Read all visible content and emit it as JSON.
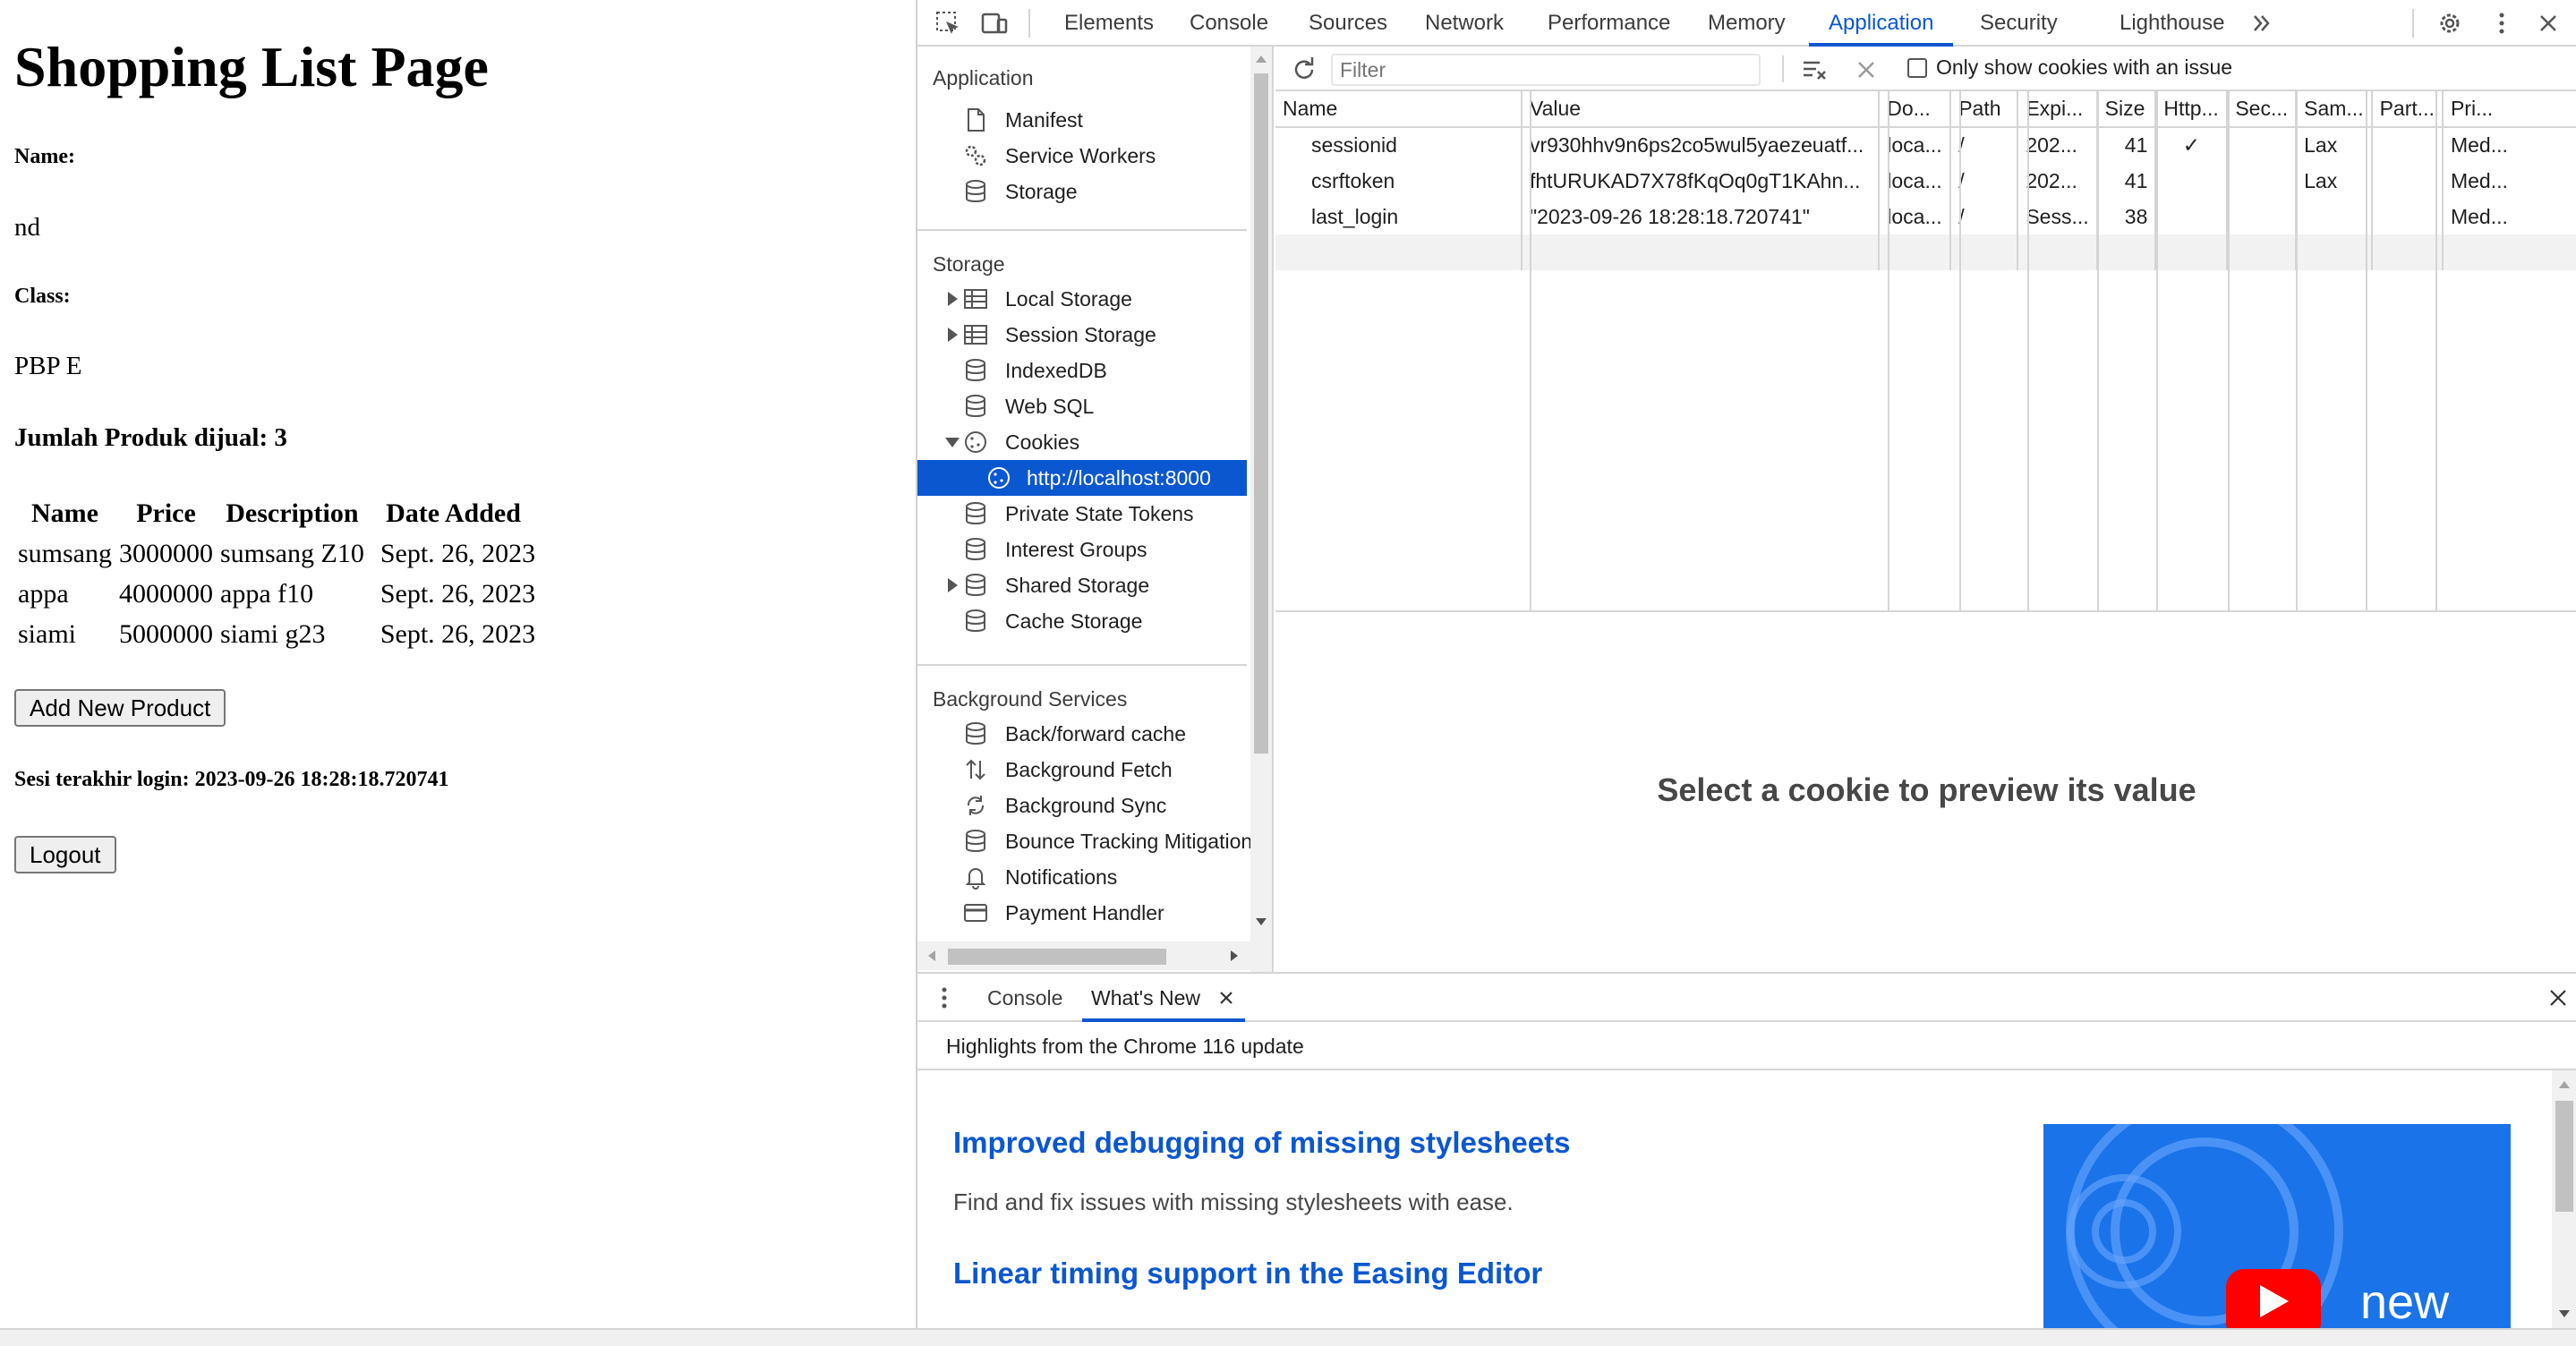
{
  "page": {
    "title": "Shopping List Page",
    "name_label": "Name:",
    "name_value": "nd",
    "class_label": "Class:",
    "class_value": "PBP E",
    "product_count": "Jumlah Produk dijual: 3",
    "table": {
      "headers": [
        "Name",
        "Price",
        "Description",
        "Date Added"
      ],
      "rows": [
        [
          "sumsang",
          "3000000",
          "sumsang Z10",
          "Sept. 26, 2023"
        ],
        [
          "appa",
          "4000000",
          "appa f10",
          "Sept. 26, 2023"
        ],
        [
          "siami",
          "5000000",
          "siami g23",
          "Sept. 26, 2023"
        ]
      ]
    },
    "add_button": "Add New Product",
    "last_login": "Sesi terakhir login: 2023-09-26 18:28:18.720741",
    "logout_button": "Logout"
  },
  "devtools": {
    "tabs": [
      "Elements",
      "Console",
      "Sources",
      "Network",
      "Performance",
      "Memory",
      "Application",
      "Security",
      "Lighthouse"
    ],
    "active_tab": "Application",
    "sidebar": {
      "application_title": "Application",
      "application_items": [
        {
          "label": "Manifest",
          "icon": "file-icon"
        },
        {
          "label": "Service Workers",
          "icon": "gears-icon"
        },
        {
          "label": "Storage",
          "icon": "database-icon"
        }
      ],
      "storage_title": "Storage",
      "storage_items": [
        {
          "label": "Local Storage",
          "icon": "table-icon",
          "expander": "right"
        },
        {
          "label": "Session Storage",
          "icon": "table-icon",
          "expander": "right"
        },
        {
          "label": "IndexedDB",
          "icon": "database-icon"
        },
        {
          "label": "Web SQL",
          "icon": "database-icon"
        },
        {
          "label": "Cookies",
          "icon": "cookie-icon",
          "expander": "down"
        },
        {
          "label": "http://localhost:8000",
          "icon": "cookie-icon",
          "selected": true
        },
        {
          "label": "Private State Tokens",
          "icon": "database-icon"
        },
        {
          "label": "Interest Groups",
          "icon": "database-icon"
        },
        {
          "label": "Shared Storage",
          "icon": "database-icon",
          "expander": "right"
        },
        {
          "label": "Cache Storage",
          "icon": "database-icon"
        }
      ],
      "background_title": "Background Services",
      "background_items": [
        {
          "label": "Back/forward cache",
          "icon": "database-icon"
        },
        {
          "label": "Background Fetch",
          "icon": "updown-arrows-icon"
        },
        {
          "label": "Background Sync",
          "icon": "sync-icon"
        },
        {
          "label": "Bounce Tracking Mitigations",
          "icon": "database-icon"
        },
        {
          "label": "Notifications",
          "icon": "bell-icon"
        },
        {
          "label": "Payment Handler",
          "icon": "card-icon"
        }
      ]
    },
    "cookies": {
      "filter_placeholder": "Filter",
      "only_issue_label": "Only show cookies with an issue",
      "columns": [
        "Name",
        "Value",
        "Do...",
        "Path",
        "Expi...",
        "Size",
        "Http...",
        "Sec...",
        "Sam...",
        "Part...",
        "Pri..."
      ],
      "rows": [
        [
          "sessionid",
          "vr930hhv9n6ps2co5wul5yaezeuatf...",
          "loca...",
          "/",
          "202...",
          "41",
          "✓",
          "",
          "Lax",
          "",
          "Med..."
        ],
        [
          "csrftoken",
          "fhtURUKAD7X78fKqOq0gT1KAhn...",
          "loca...",
          "/",
          "202...",
          "41",
          "",
          "",
          "Lax",
          "",
          "Med..."
        ],
        [
          "last_login",
          "\"2023-09-26 18:28:18.720741\"",
          "loca...",
          "/",
          "Sess...",
          "38",
          "",
          "",
          "",
          "",
          "Med..."
        ]
      ],
      "preview_message": "Select a cookie to preview its value"
    },
    "drawer": {
      "tabs": [
        "Console",
        "What's New"
      ],
      "active_tab": "What's New",
      "highlights": "Highlights from the Chrome 116 update",
      "items": [
        {
          "heading": "Improved debugging of missing stylesheets",
          "text": "Find and fix issues with missing stylesheets with ease."
        },
        {
          "heading": "Linear timing support in the Easing Editor",
          "text": ""
        }
      ],
      "promo_text": "new"
    },
    "colors": {
      "accent": "#0b57d0",
      "selected_bg": "#0b57d0",
      "promo_bg": "#1a73e8"
    }
  }
}
